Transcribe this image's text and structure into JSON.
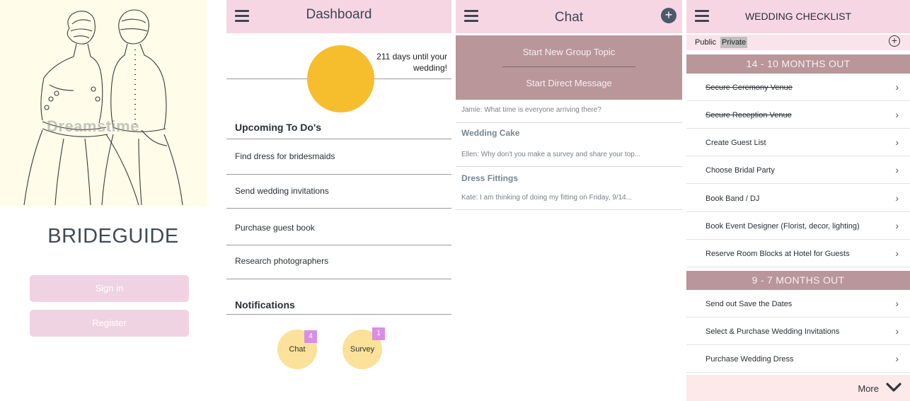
{
  "login": {
    "brand": "BRIDEGUIDE",
    "watermark": "Dreamstime",
    "signin_label": "Sign in",
    "register_label": "Register"
  },
  "dashboard": {
    "title": "Dashboard",
    "countdown": "211 days until your wedding!",
    "upcoming_title": "Upcoming To Do's",
    "todos": [
      "Find dress for bridesmaids",
      "Send wedding invitations",
      "Purchase guest book",
      "Research photographers"
    ],
    "notifications_title": "Notifications",
    "notifications": [
      {
        "label": "Chat",
        "count": "4"
      },
      {
        "label": "Survey",
        "count": "1"
      }
    ]
  },
  "chat": {
    "title": "Chat",
    "new_group_label": "Start New Group Topic",
    "direct_label": "Start Direct Message",
    "preview_1": "Jamie: What time is everyone arriving there?",
    "threads": [
      {
        "title": "Wedding Cake",
        "preview": "Ellen: Why don't you make a survey and share your top..."
      },
      {
        "title": "Dress Fittings",
        "preview": "Kate: I am thinking of doing my fitting on Friday, 9/14..."
      }
    ]
  },
  "checklist": {
    "title": "WEDDING CHECKLIST",
    "public_label": "Public",
    "private_label": "Private",
    "sections": [
      {
        "label": "14 - 10 MONTHS OUT",
        "items": [
          {
            "label": "Secure Ceremony Venue",
            "done": true
          },
          {
            "label": "Secure Reception Venue",
            "done": true
          },
          {
            "label": "Create Guest List",
            "done": false
          },
          {
            "label": "Choose Bridal Party",
            "done": false
          },
          {
            "label": "Book Band / DJ",
            "done": false
          },
          {
            "label": "Book Event Designer (Florist, decor, lighting)",
            "done": false
          },
          {
            "label": "Reserve Room Blocks at Hotel for Guests",
            "done": false
          }
        ]
      },
      {
        "label": "9 - 7 MONTHS OUT",
        "items": [
          {
            "label": "Send out Save the Dates",
            "done": false
          },
          {
            "label": "Select & Purchase Wedding Invitations",
            "done": false
          },
          {
            "label": "Purchase Wedding Dress",
            "done": false
          }
        ]
      }
    ],
    "more_label": "More"
  },
  "colors": {
    "header_pink": "#f7d6e3",
    "band_mauve": "#b8969a",
    "button_pink": "#efd3e3",
    "countdown_circle": "#f6bd2d",
    "notif_circle": "#fbe19a",
    "badge": "#d98ee6"
  }
}
